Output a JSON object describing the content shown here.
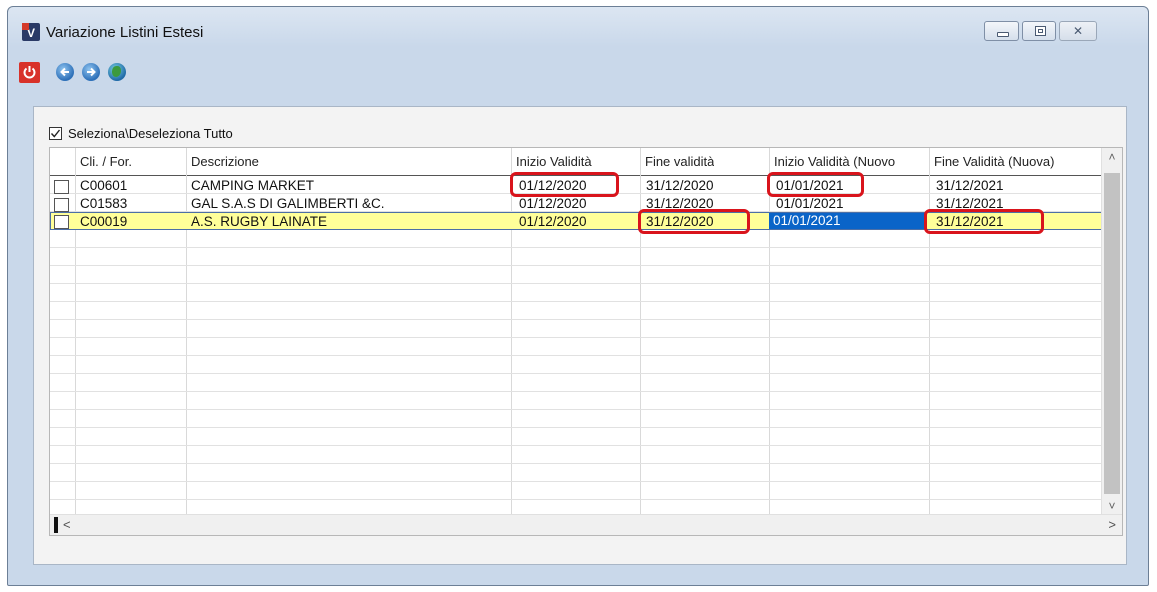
{
  "window": {
    "title": "Variazione Listini Estesi",
    "app_icon_letter": "V",
    "controls": {
      "minimize": "minimize-icon",
      "maximize": "maximize-icon",
      "close_glyph": "✕"
    }
  },
  "toolbar": {
    "buttons": [
      {
        "name": "exit-button",
        "icon": "power-icon"
      },
      {
        "name": "back-button",
        "icon": "arrow-left-icon"
      },
      {
        "name": "forward-button",
        "icon": "arrow-right-icon"
      },
      {
        "name": "globe-button",
        "icon": "globe-icon"
      }
    ]
  },
  "select_all": {
    "label": "Seleziona\\Deseleziona Tutto",
    "checked": true
  },
  "grid": {
    "columns": [
      "Cli. / For.",
      "Descrizione",
      "Inizio Validità",
      "Fine validità",
      "Inizio Validità (Nuovo",
      "Fine Validità (Nuova)"
    ],
    "rows": [
      [
        "C00601",
        "CAMPING MARKET",
        "01/12/2020",
        "31/12/2020",
        "01/01/2021",
        "31/12/2021"
      ],
      [
        "C01583",
        "GAL S.A.S DI GALIMBERTI &C.",
        "01/12/2020",
        "31/12/2020",
        "01/01/2021",
        "31/12/2021"
      ],
      [
        "C00019",
        "A.S. RUGBY LAINATE",
        "01/12/2020",
        "31/12/2020",
        "01/01/2021",
        "31/12/2021"
      ]
    ],
    "selected_row": 2,
    "highlight_color": "#ffff99",
    "focus_color": "#0a64c8",
    "annotation_color": "#d9141c"
  },
  "scroll": {
    "up": "˄",
    "down": "˅",
    "left": "<",
    "right": ">"
  }
}
